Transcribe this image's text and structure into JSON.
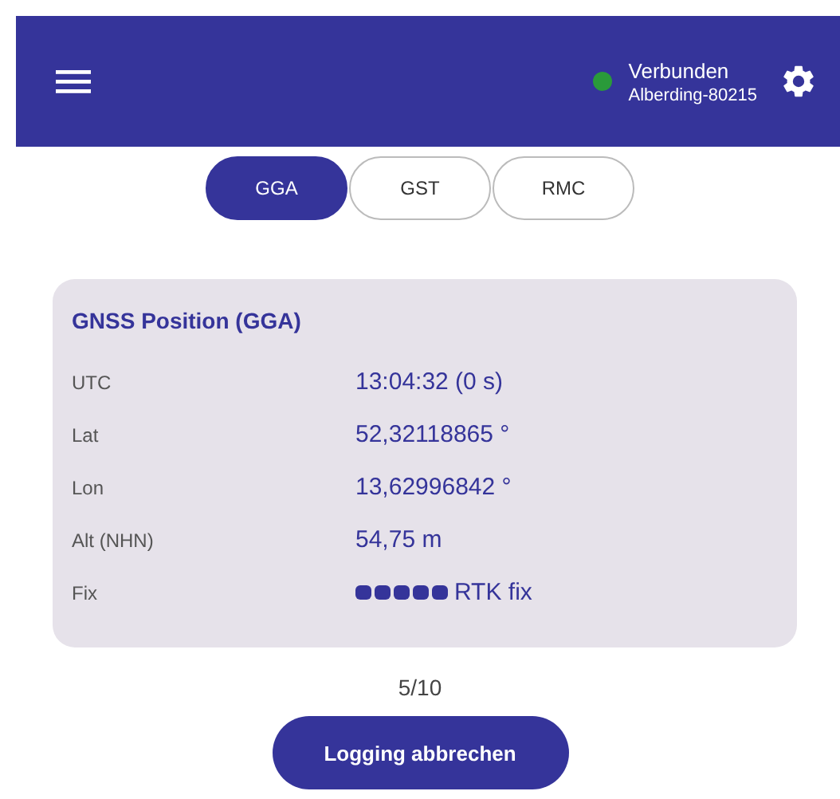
{
  "app_bar": {
    "connection": {
      "status": "Verbunden",
      "device": "Alberding-80215",
      "color": "#2a9a3a"
    }
  },
  "tabs": [
    {
      "label": "GGA",
      "selected": true
    },
    {
      "label": "GST",
      "selected": false
    },
    {
      "label": "RMC",
      "selected": false
    }
  ],
  "card": {
    "title": "GNSS Position (GGA)",
    "rows": [
      {
        "label": "UTC",
        "value": "13:04:32 (0 s)",
        "kind": "text"
      },
      {
        "label": "Lat",
        "value": "52,32118865 °",
        "kind": "text"
      },
      {
        "label": "Lon",
        "value": "13,62996842 °",
        "kind": "text"
      },
      {
        "label": "Alt (NHN)",
        "value": "54,75 m",
        "kind": "text"
      },
      {
        "label": "Fix",
        "value": "RTK fix",
        "kind": "quality",
        "stars": 5
      }
    ]
  },
  "progress": "5/10",
  "buttons": [
    "Logging abbrechen"
  ]
}
